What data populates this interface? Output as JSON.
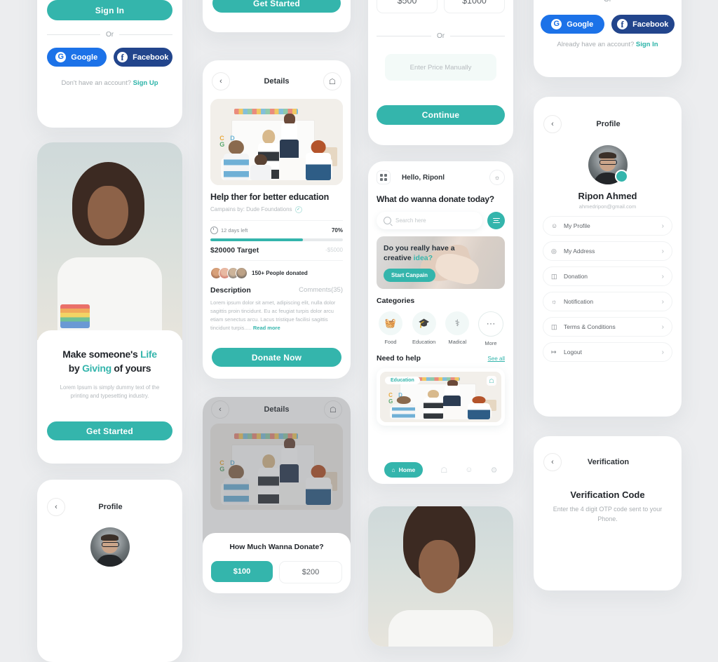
{
  "theme": {
    "background": "#ecedef",
    "accent": "#34b5ac",
    "google_blue": "#1c72e8",
    "facebook_blue": "#22458c",
    "text_dark": "#22262b",
    "text_muted": "#b3b8bc"
  },
  "signin_panel": {
    "submit_label": "Sign In",
    "or_label": "Or",
    "google_label": "Google",
    "facebook_label": "Facebook",
    "footer_prompt": "Don't have an account?",
    "footer_link": "Sign Up"
  },
  "onboarding_panel": {
    "title_line1_a": "Make someone's ",
    "title_line1_b": "Life",
    "title_line2_a": "by ",
    "title_line2_b": "Giving",
    "title_line2_c": " of yours",
    "body": "Lorem Ipsum is simply dummy text of the printing and typesetting industry.",
    "cta_label": "Get Started"
  },
  "getstarted_panel": {
    "cta_label": "Get Started"
  },
  "profile_bottom_left_panel": {
    "title": "Profile"
  },
  "details_panel": {
    "header_title": "Details",
    "back_icon": "chevron-left-icon",
    "bookmark_icon": "bookmark-icon",
    "campaign_title": "Help ther for better education",
    "campaign_by": "Campains by: Dude Foundations",
    "verified_icon": "verified-check-icon",
    "days_left": "12 days left",
    "percent": "70%",
    "progress_value": 70,
    "target": "$20000 Target",
    "raised": "-$5000",
    "donors_text": "150+ People donated",
    "description_label": "Description",
    "comments_label": "Comments(35)",
    "description_body": "Lorem ipsum dolor sit amet, adipiscing elit, nulla dolor sagittis proin tincidunt. Eu ac feugiat turpis dolor arcu etiam senectus arcu. Lacus tristique facilisi sagittis tincidunt turpis.....",
    "read_more": "Read more",
    "cta_label": "Donate Now"
  },
  "donate_sheet_panel": {
    "header_title": "Details",
    "sheet_title": "How Much Wanna Donate?",
    "amount_selected": "$100",
    "amount_other": "$200"
  },
  "amount_panel": {
    "amount_a": "$500",
    "amount_b": "$1000",
    "or_label": "Or",
    "manual_placeholder": "Enter Price Manually",
    "cta_label": "Continue"
  },
  "home_panel": {
    "grid_icon": "grid-menu-icon",
    "greeting": "Hello, Riponl",
    "bell_icon": "bell-icon",
    "question": "What do wanna donate today?",
    "search_placeholder": "Search here",
    "search_icon": "search-icon",
    "filter_icon": "filter-icon",
    "banner_line1": "Do you really have a",
    "banner_line2_a": "creative ",
    "banner_line2_b": "idea?",
    "banner_cta": "Start Canpain",
    "categories_title": "Categories",
    "categories": [
      {
        "label": "Food",
        "icon": "food-basket-icon",
        "glyph": "🧺"
      },
      {
        "label": "Education",
        "icon": "graduation-cap-icon",
        "glyph": "🎓"
      },
      {
        "label": "Madical",
        "icon": "medical-cross-icon",
        "glyph": "⚕"
      },
      {
        "label": "More",
        "icon": "more-dots-icon",
        "glyph": "⋯"
      }
    ],
    "need_help_title": "Need to help",
    "see_all": "See all",
    "card_tag": "Education",
    "card_bookmark_icon": "bookmark-icon",
    "tabs": [
      {
        "label": "Home",
        "icon": "home-icon",
        "glyph": "⌂",
        "active": true
      },
      {
        "label": "",
        "icon": "bookmark-icon",
        "glyph": "☐",
        "active": false
      },
      {
        "label": "",
        "icon": "person-icon",
        "glyph": "●",
        "active": false
      },
      {
        "label": "",
        "icon": "settings-icon",
        "glyph": "⚙",
        "active": false
      }
    ]
  },
  "signup_panel": {
    "or_label": "Or",
    "google_label": "Google",
    "facebook_label": "Facebook",
    "footer_prompt": "Already have an account?",
    "footer_link": "Sign In"
  },
  "profile_panel": {
    "header_title": "Profile",
    "back_icon": "chevron-left-icon",
    "name": "Ripon Ahmed",
    "email": "ahmedripon@gmail.com",
    "items": [
      {
        "label": "My Profile",
        "icon": "person-icon",
        "glyph": "☺"
      },
      {
        "label": "My Address",
        "icon": "location-pin-icon",
        "glyph": "⌖"
      },
      {
        "label": "Donation",
        "icon": "wallet-icon",
        "glyph": "▤"
      },
      {
        "label": "Notification",
        "icon": "bell-icon",
        "glyph": "⚇"
      },
      {
        "label": "Terms & Conditions",
        "icon": "document-icon",
        "glyph": "☰"
      },
      {
        "label": "Logout",
        "icon": "logout-icon",
        "glyph": "↪"
      }
    ],
    "chevron_icon": "chevron-right-icon"
  },
  "verification_panel": {
    "header_title": "Verification",
    "back_icon": "chevron-left-icon",
    "title": "Verification Code",
    "subtitle": "Enter the 4 digit OTP code sent to your Phone."
  }
}
